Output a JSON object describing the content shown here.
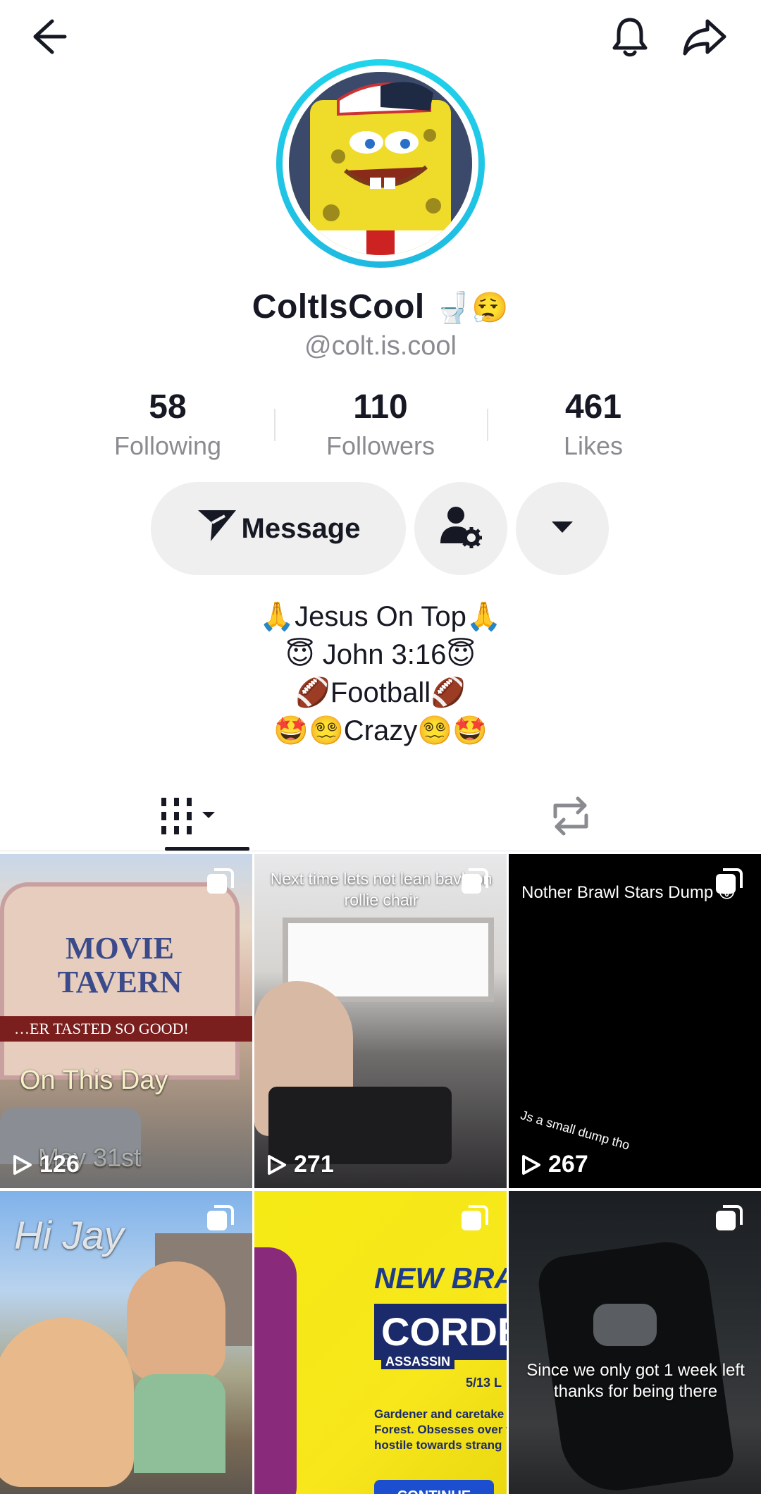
{
  "profile": {
    "display_name": "ColtIsCool",
    "name_emoji": "🚽😮‍💨",
    "handle": "@colt.is.cool"
  },
  "stats": [
    {
      "value": "58",
      "label": "Following"
    },
    {
      "value": "110",
      "label": "Followers"
    },
    {
      "value": "461",
      "label": "Likes"
    }
  ],
  "actions": {
    "message_label": "Message"
  },
  "bio": [
    "🙏Jesus On Top🙏",
    "😇 John 3:16😇",
    "🏈Football🏈",
    "🤩😵‍💫Crazy😵‍💫🤩"
  ],
  "videos": [
    {
      "views": "126",
      "caption": "On This Day",
      "sub_caption": "May 31st",
      "sign_text": "MOVIE TAVERN",
      "sign_sub": "…ER TASTED SO GOOD!"
    },
    {
      "views": "271",
      "caption": "Next time lets not lean bavk on rollie chair"
    },
    {
      "views": "267",
      "caption": "Nother Brawl Stars Dump 😛",
      "small_caption": "Js a small dump tho"
    },
    {
      "views": "",
      "caption": "Hi Jay"
    },
    {
      "views": "",
      "title_line1": "NEW BRA",
      "title_line2": "CORDE",
      "tag": "ASSASSIN",
      "date": "5/13 L",
      "desc": "Gardener and caretake Forest. Obsesses over t hostile towards strang",
      "button": "CONTINUE"
    },
    {
      "views": "",
      "caption": "Since we only got 1 week left thanks for being there"
    }
  ],
  "colors": {
    "ring": "#20d5ec",
    "muted_text": "#8a8b91",
    "button_bg": "#efefef"
  }
}
